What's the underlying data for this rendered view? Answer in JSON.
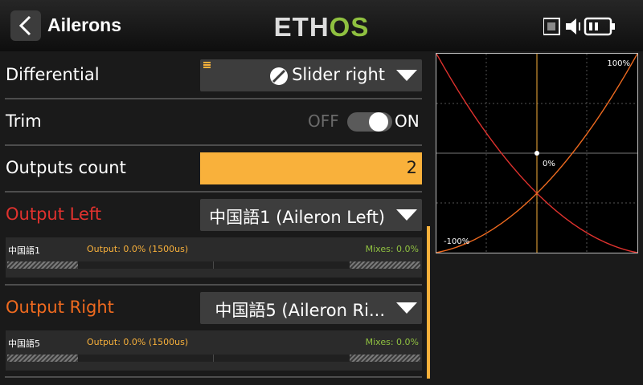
{
  "header": {
    "title": "Ailerons",
    "logo_text": "ETHOS",
    "back_icon": "chevron-left-icon",
    "status_icons": [
      "square-indicator-icon",
      "speaker-icon",
      "battery-icon"
    ]
  },
  "form": {
    "differential": {
      "label": "Differential",
      "value": "Slider right",
      "icon": "slash-circle-icon"
    },
    "trim": {
      "label": "Trim",
      "off_label": "OFF",
      "on_label": "ON",
      "state": "on"
    },
    "outputs_count": {
      "label": "Outputs count",
      "value": "2"
    },
    "output_left": {
      "label": "Output Left",
      "label_color": "#e0322e",
      "value": "中国語1 (Aileron Left)",
      "monitor": {
        "channel": "中国語1",
        "output": "Output: 0.0% (1500us)",
        "mixes": "Mixes: 0.0%"
      }
    },
    "output_right": {
      "label": "Output Right",
      "label_color": "#ef6a1f",
      "value": "中国語5 (Aileron Ri...",
      "monitor": {
        "channel": "中国語5",
        "output": "Output: 0.0% (1500us)",
        "mixes": "Mixes: 0.0%"
      }
    }
  },
  "curve": {
    "top_label": "100%",
    "center_label": "0%",
    "bottom_label": "-100%",
    "curves": [
      {
        "name": "left",
        "color": "#e0322e"
      },
      {
        "name": "right",
        "color": "#ef6a1f"
      }
    ]
  },
  "colors": {
    "accent": "#f9b13b",
    "mixes": "#8fc040",
    "background": "#1a1a1a"
  }
}
